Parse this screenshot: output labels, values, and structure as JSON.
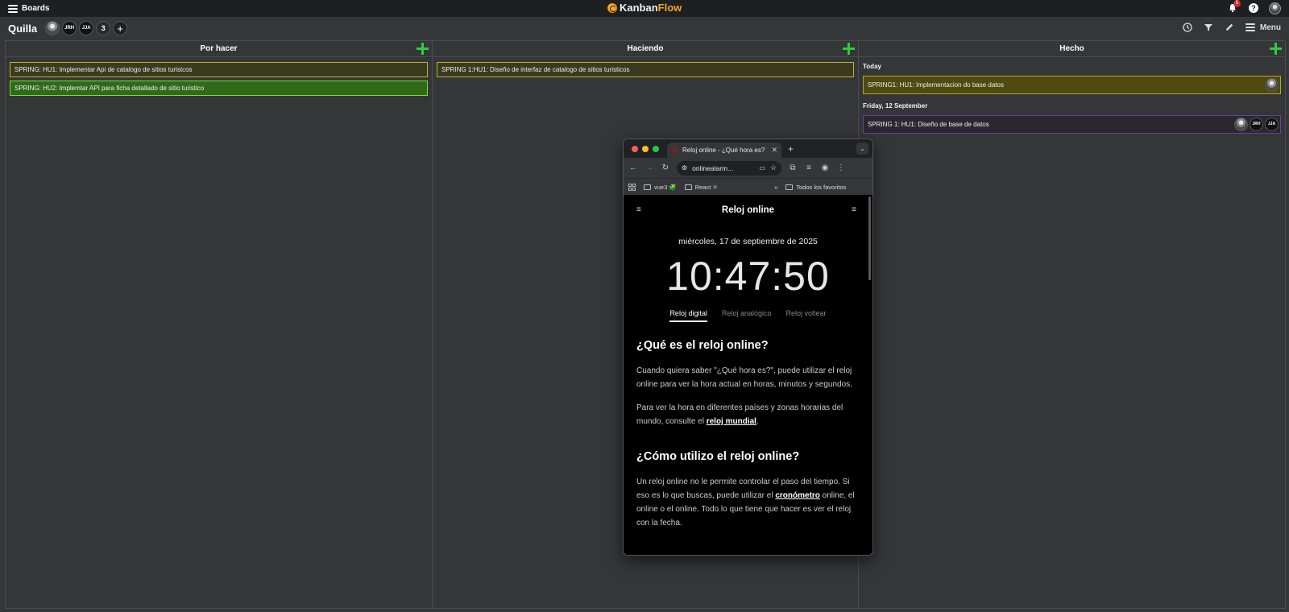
{
  "topbar": {
    "boards_label": "Boards",
    "logo_kanban": "Kanban",
    "logo_flow": "Flow",
    "notif_count": "5"
  },
  "board": {
    "title": "Quilla",
    "members": [
      "JRH",
      "JJA"
    ],
    "member_count": "3",
    "menu_label": "Menu"
  },
  "columns": [
    {
      "title": "Por hacer",
      "tasks": [
        "SPRING: HU1: Implementar Api de catalogo de sitios turistcos",
        "SPRING: HU2: Implemtar API para ficha detallado de sitio turistico"
      ]
    },
    {
      "title": "Haciendo",
      "tasks": [
        "SPRING 1:HU1: Diseño de interfaz de catalogo de sitios turisticos"
      ]
    },
    {
      "title": "Hecho",
      "groups": [
        {
          "label": "Today",
          "task": "SPRING1: HU1: Implementacion do base datos"
        },
        {
          "label": "Friday, 12 September",
          "task": "SPRING 1: HU1: Diseño de base de datos",
          "avatars": [
            "JRH",
            "JJA"
          ]
        }
      ]
    }
  ],
  "browser": {
    "tab_title": "Reloj online - ¿Qué hora es?",
    "url": "onlinealarm...",
    "bookmarks": [
      "vue3 🧩",
      "React ⚛",
      "Todos los favoritos"
    ],
    "page": {
      "title": "Reloj online",
      "date": "miércoles, 17 de septiembre de 2025",
      "time": "10:47:50",
      "modes": [
        "Reloj digital",
        "Reloj analógico",
        "Reloj voltear"
      ],
      "h1": "¿Qué es el reloj online?",
      "p1": "Cuando quiera saber \"¿Qué hora es?\", puede utilizar el reloj online para ver la hora actual en horas, minutos y segundos.",
      "p2_before": "Para ver la hora en diferentes países y zonas horarias del mundo, consulte el ",
      "p2_link": "reloj mundial",
      "p2_after": ".",
      "h2": "¿Cómo utilizo el reloj online?",
      "p3_before": "Un reloj online no le permite controlar el paso del tiempo. Si eso es lo que buscas, puede utilizar el ",
      "p3_link": "cronómetro",
      "p3_after": " online, el online o el online. Todo lo que tiene que hacer es ver el reloj con la fecha."
    }
  },
  "colors": {
    "bg": "#343638",
    "topbar": "#1e1f20",
    "add_green": "#2ecc40",
    "yellow_border": "#c3b12e",
    "green_card": "#2f6a1a",
    "purple_border": "#6b3fa0"
  },
  "icons": [
    "hamburger-icon",
    "bell-icon",
    "help-icon",
    "clock-icon",
    "filter-icon",
    "pencil-icon",
    "plus-icon"
  ]
}
